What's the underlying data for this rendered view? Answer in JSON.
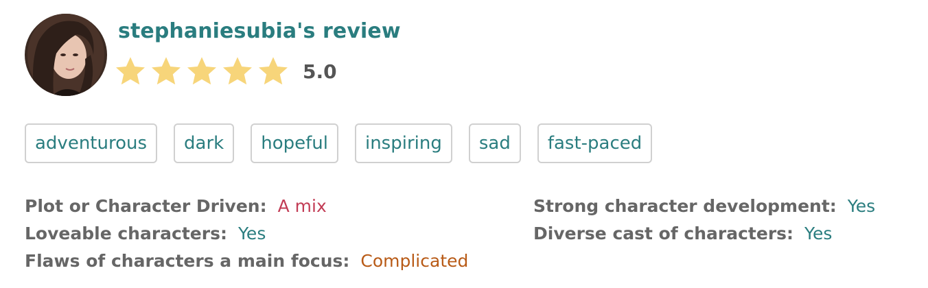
{
  "review": {
    "title": "stephaniesubia's review",
    "rating_text": "5.0",
    "rating_value": 5.0,
    "rating_max": 5,
    "star_color": "#f7d57a"
  },
  "tags": [
    "adventurous",
    "dark",
    "hopeful",
    "inspiring",
    "sad",
    "fast-paced"
  ],
  "details": {
    "left": [
      {
        "label": "Plot or Character Driven:",
        "value": "A mix",
        "color": "#c23c55"
      },
      {
        "label": "Loveable characters:",
        "value": "Yes",
        "color": "#2a7d7f"
      },
      {
        "label": "Flaws of characters a main focus:",
        "value": "Complicated",
        "color": "#b85a16"
      }
    ],
    "right": [
      {
        "label": "Strong character development:",
        "value": "Yes",
        "color": "#2a7d7f"
      },
      {
        "label": "Diverse cast of characters:",
        "value": "Yes",
        "color": "#2a7d7f"
      }
    ]
  },
  "colors": {
    "accent_teal": "#2a7d7f",
    "tag_border": "#d0d0d0",
    "label_gray": "#666666"
  }
}
